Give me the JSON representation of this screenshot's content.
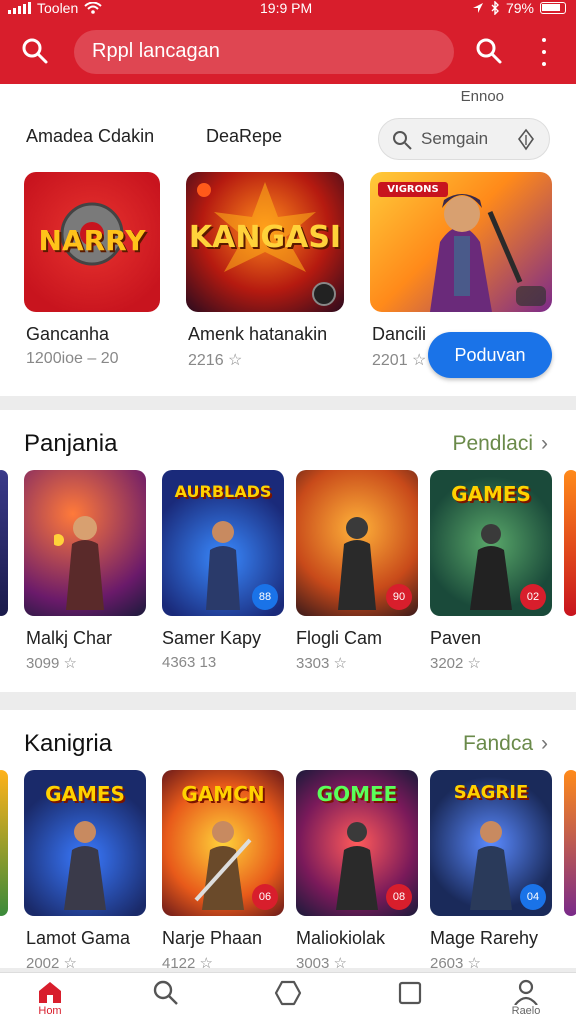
{
  "status": {
    "carrier": "Toolen",
    "time": "19:9 PM",
    "battery": "79%"
  },
  "header": {
    "search_text": "Rppl lancagan"
  },
  "featured": {
    "tiny_label": "Ennoo",
    "filters": [
      "Amadea Cdakin",
      "DeaRepe"
    ],
    "search_pill": "Semgain",
    "apps": [
      {
        "logo": "NARRY",
        "name": "Gancanha",
        "sub": "1200ioe – 20"
      },
      {
        "logo": "KANGASI",
        "name": "Amenk hatanakin",
        "sub": "2216 ☆"
      },
      {
        "logo": "VIGRONS",
        "name": "Dancili",
        "sub": "2201 ☆"
      }
    ],
    "install_label": "Poduvan"
  },
  "section1": {
    "title": "Panjania",
    "more": "Pendlaci",
    "items": [
      {
        "tile_title": "",
        "name": "Malkj Char",
        "meta": "3099 ☆",
        "badge": ""
      },
      {
        "tile_title": "AURBLADS",
        "name": "Samer Kapy",
        "meta": "4363 13",
        "badge": "88"
      },
      {
        "tile_title": "",
        "name": "Flogli Cam",
        "meta": "3303 ☆",
        "badge": "90"
      },
      {
        "tile_title": "GAMES",
        "name": "Paven",
        "meta": "3202 ☆",
        "badge": "02"
      }
    ]
  },
  "section2": {
    "title": "Kanigria",
    "more": "Fandca",
    "items": [
      {
        "tile_title": "GAMES",
        "name": "Lamot Gama",
        "meta": "2002 ☆",
        "badge": ""
      },
      {
        "tile_title": "GAMCN",
        "name": "Narje Phaan",
        "meta": "4122 ☆",
        "badge": "06"
      },
      {
        "tile_title": "GOMEE",
        "name": "Maliokiolak",
        "meta": "3003 ☆",
        "badge": "08"
      },
      {
        "tile_title": "SAGRIE",
        "name": "Mage Rarehy",
        "meta": "2603 ☆",
        "badge": "04"
      }
    ]
  },
  "bottom_nav": {
    "home": "Hom",
    "profile": "Raelo"
  }
}
